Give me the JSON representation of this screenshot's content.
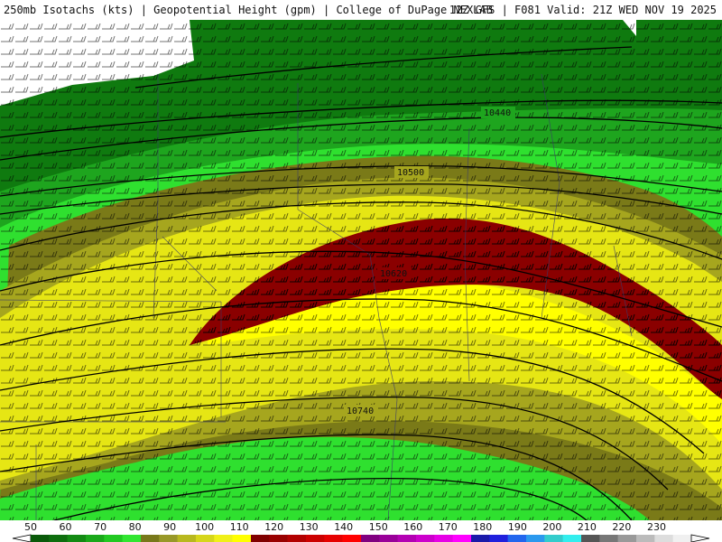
{
  "header": {
    "left": "250mb Isotachs (kts) | Geopotential Height (gpm) | College of DuPage NEXLAB",
    "right": "12Z GFS | F081 Valid: 21Z WED NOV 19 2025"
  },
  "height_labels": [
    "10440",
    "10500",
    "10620",
    "10740"
  ],
  "colorbar": {
    "ticks": [
      "50",
      "60",
      "70",
      "80",
      "90",
      "100",
      "110",
      "120",
      "130",
      "140",
      "150",
      "160",
      "170",
      "180",
      "190",
      "200",
      "210",
      "220",
      "230"
    ],
    "colors": [
      "#0a5a0a",
      "#0e6e0e",
      "#138a13",
      "#1aa81a",
      "#22c922",
      "#31e631",
      "#78781a",
      "#989828",
      "#b8b81e",
      "#d6d61a",
      "#f0f018",
      "#ffff00",
      "#800000",
      "#990000",
      "#b30000",
      "#cc0000",
      "#e60000",
      "#ff0000",
      "#800080",
      "#990099",
      "#b300b3",
      "#cc00cc",
      "#e600e6",
      "#ff00ff",
      "#1a1aaa",
      "#2020dd",
      "#2266ee",
      "#2b99ee",
      "#33cccc",
      "#33eeee",
      "#555555",
      "#777777",
      "#999999",
      "#bbbbbb",
      "#dddddd",
      "#f0f0f0"
    ]
  }
}
